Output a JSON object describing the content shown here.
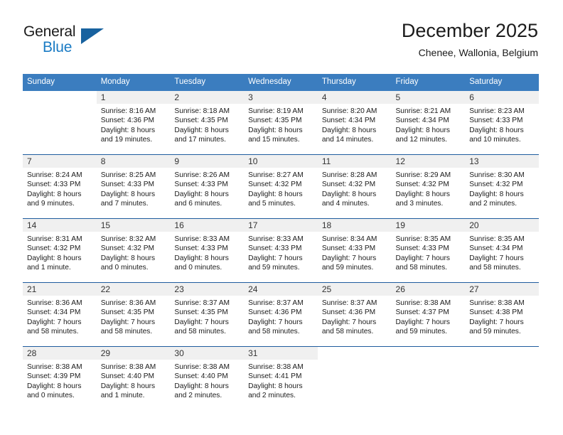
{
  "brand": {
    "name_top": "General",
    "name_bottom": "Blue",
    "triangle_color": "#18629f",
    "blue_color": "#1a7bc4"
  },
  "header": {
    "title": "December 2025",
    "subtitle": "Chenee, Wallonia, Belgium"
  },
  "theme": {
    "header_bg": "#3b7dbf",
    "row_divider": "#1f5c9e",
    "daynum_band": "#f0f0f0",
    "text": "#1b1b1b"
  },
  "weekdays": [
    "Sunday",
    "Monday",
    "Tuesday",
    "Wednesday",
    "Thursday",
    "Friday",
    "Saturday"
  ],
  "weeks": [
    [
      {
        "day": "",
        "lines": []
      },
      {
        "day": "1",
        "lines": [
          "Sunrise: 8:16 AM",
          "Sunset: 4:36 PM",
          "Daylight: 8 hours",
          "and 19 minutes."
        ]
      },
      {
        "day": "2",
        "lines": [
          "Sunrise: 8:18 AM",
          "Sunset: 4:35 PM",
          "Daylight: 8 hours",
          "and 17 minutes."
        ]
      },
      {
        "day": "3",
        "lines": [
          "Sunrise: 8:19 AM",
          "Sunset: 4:35 PM",
          "Daylight: 8 hours",
          "and 15 minutes."
        ]
      },
      {
        "day": "4",
        "lines": [
          "Sunrise: 8:20 AM",
          "Sunset: 4:34 PM",
          "Daylight: 8 hours",
          "and 14 minutes."
        ]
      },
      {
        "day": "5",
        "lines": [
          "Sunrise: 8:21 AM",
          "Sunset: 4:34 PM",
          "Daylight: 8 hours",
          "and 12 minutes."
        ]
      },
      {
        "day": "6",
        "lines": [
          "Sunrise: 8:23 AM",
          "Sunset: 4:33 PM",
          "Daylight: 8 hours",
          "and 10 minutes."
        ]
      }
    ],
    [
      {
        "day": "7",
        "lines": [
          "Sunrise: 8:24 AM",
          "Sunset: 4:33 PM",
          "Daylight: 8 hours",
          "and 9 minutes."
        ]
      },
      {
        "day": "8",
        "lines": [
          "Sunrise: 8:25 AM",
          "Sunset: 4:33 PM",
          "Daylight: 8 hours",
          "and 7 minutes."
        ]
      },
      {
        "day": "9",
        "lines": [
          "Sunrise: 8:26 AM",
          "Sunset: 4:33 PM",
          "Daylight: 8 hours",
          "and 6 minutes."
        ]
      },
      {
        "day": "10",
        "lines": [
          "Sunrise: 8:27 AM",
          "Sunset: 4:32 PM",
          "Daylight: 8 hours",
          "and 5 minutes."
        ]
      },
      {
        "day": "11",
        "lines": [
          "Sunrise: 8:28 AM",
          "Sunset: 4:32 PM",
          "Daylight: 8 hours",
          "and 4 minutes."
        ]
      },
      {
        "day": "12",
        "lines": [
          "Sunrise: 8:29 AM",
          "Sunset: 4:32 PM",
          "Daylight: 8 hours",
          "and 3 minutes."
        ]
      },
      {
        "day": "13",
        "lines": [
          "Sunrise: 8:30 AM",
          "Sunset: 4:32 PM",
          "Daylight: 8 hours",
          "and 2 minutes."
        ]
      }
    ],
    [
      {
        "day": "14",
        "lines": [
          "Sunrise: 8:31 AM",
          "Sunset: 4:32 PM",
          "Daylight: 8 hours",
          "and 1 minute."
        ]
      },
      {
        "day": "15",
        "lines": [
          "Sunrise: 8:32 AM",
          "Sunset: 4:32 PM",
          "Daylight: 8 hours",
          "and 0 minutes."
        ]
      },
      {
        "day": "16",
        "lines": [
          "Sunrise: 8:33 AM",
          "Sunset: 4:33 PM",
          "Daylight: 8 hours",
          "and 0 minutes."
        ]
      },
      {
        "day": "17",
        "lines": [
          "Sunrise: 8:33 AM",
          "Sunset: 4:33 PM",
          "Daylight: 7 hours",
          "and 59 minutes."
        ]
      },
      {
        "day": "18",
        "lines": [
          "Sunrise: 8:34 AM",
          "Sunset: 4:33 PM",
          "Daylight: 7 hours",
          "and 59 minutes."
        ]
      },
      {
        "day": "19",
        "lines": [
          "Sunrise: 8:35 AM",
          "Sunset: 4:33 PM",
          "Daylight: 7 hours",
          "and 58 minutes."
        ]
      },
      {
        "day": "20",
        "lines": [
          "Sunrise: 8:35 AM",
          "Sunset: 4:34 PM",
          "Daylight: 7 hours",
          "and 58 minutes."
        ]
      }
    ],
    [
      {
        "day": "21",
        "lines": [
          "Sunrise: 8:36 AM",
          "Sunset: 4:34 PM",
          "Daylight: 7 hours",
          "and 58 minutes."
        ]
      },
      {
        "day": "22",
        "lines": [
          "Sunrise: 8:36 AM",
          "Sunset: 4:35 PM",
          "Daylight: 7 hours",
          "and 58 minutes."
        ]
      },
      {
        "day": "23",
        "lines": [
          "Sunrise: 8:37 AM",
          "Sunset: 4:35 PM",
          "Daylight: 7 hours",
          "and 58 minutes."
        ]
      },
      {
        "day": "24",
        "lines": [
          "Sunrise: 8:37 AM",
          "Sunset: 4:36 PM",
          "Daylight: 7 hours",
          "and 58 minutes."
        ]
      },
      {
        "day": "25",
        "lines": [
          "Sunrise: 8:37 AM",
          "Sunset: 4:36 PM",
          "Daylight: 7 hours",
          "and 58 minutes."
        ]
      },
      {
        "day": "26",
        "lines": [
          "Sunrise: 8:38 AM",
          "Sunset: 4:37 PM",
          "Daylight: 7 hours",
          "and 59 minutes."
        ]
      },
      {
        "day": "27",
        "lines": [
          "Sunrise: 8:38 AM",
          "Sunset: 4:38 PM",
          "Daylight: 7 hours",
          "and 59 minutes."
        ]
      }
    ],
    [
      {
        "day": "28",
        "lines": [
          "Sunrise: 8:38 AM",
          "Sunset: 4:39 PM",
          "Daylight: 8 hours",
          "and 0 minutes."
        ]
      },
      {
        "day": "29",
        "lines": [
          "Sunrise: 8:38 AM",
          "Sunset: 4:40 PM",
          "Daylight: 8 hours",
          "and 1 minute."
        ]
      },
      {
        "day": "30",
        "lines": [
          "Sunrise: 8:38 AM",
          "Sunset: 4:40 PM",
          "Daylight: 8 hours",
          "and 2 minutes."
        ]
      },
      {
        "day": "31",
        "lines": [
          "Sunrise: 8:38 AM",
          "Sunset: 4:41 PM",
          "Daylight: 8 hours",
          "and 2 minutes."
        ]
      },
      {
        "day": "",
        "lines": []
      },
      {
        "day": "",
        "lines": []
      },
      {
        "day": "",
        "lines": []
      }
    ]
  ]
}
